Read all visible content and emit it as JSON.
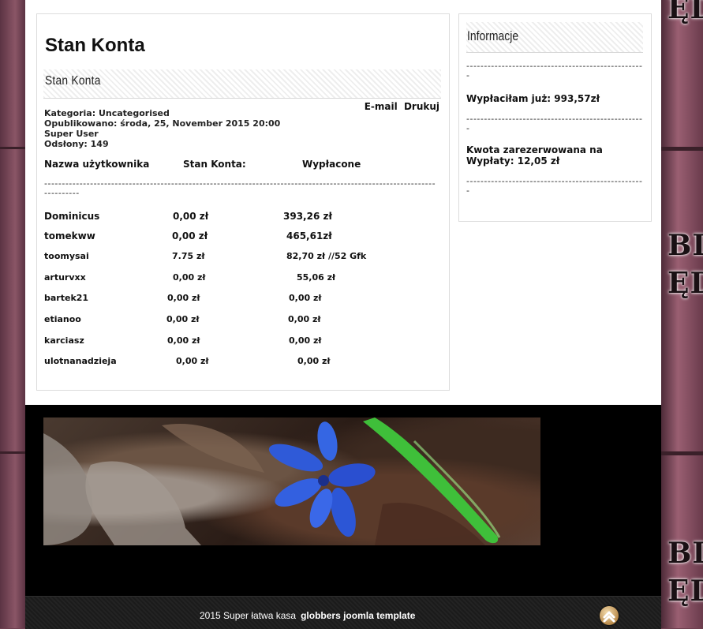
{
  "article": {
    "page_title": "Stan Konta",
    "title": "Stan Konta",
    "tools": {
      "email": "E-mail",
      "print": "Drukuj"
    },
    "meta": {
      "category": "Kategoria: Uncategorised",
      "published": "Opublikowano: środa, 25, November 2015 20:00",
      "author": "Super User",
      "hits": "Odsłony: 149"
    },
    "columns": {
      "user": "Nazwa użytkownika",
      "balance": "Stan Konta:",
      "paid": "Wypłacone"
    },
    "divider": "-------------------------------------------------------------------------------------------------------------------------",
    "rows": [
      {
        "user": "Dominicus",
        "balance": "0,00 zł",
        "paid": "393,26 zł"
      },
      {
        "user": "tomekww",
        "balance": "0,00 zł",
        "paid": "465,61zł"
      },
      {
        "user": "toomysai",
        "balance": "7.75 zł",
        "paid": "82,70 zł  //52 Gfk"
      },
      {
        "user": " arturvxx",
        "balance": "0,00 zł",
        "paid": "55,06 zł"
      },
      {
        "user": "bartek21",
        "balance": "0,00 zł",
        "paid": "0,00 zł"
      },
      {
        "user": "etianoo",
        "balance": "0,00 zł",
        "paid": "0,00 zł"
      },
      {
        "user": "karciasz",
        "balance": "0,00 zł",
        "paid": "0,00 zł"
      },
      {
        "user": "ulotnanadzieja",
        "balance": "0,00 zł",
        "paid": "0,00 zł"
      }
    ]
  },
  "sidebar": {
    "title": "Informacje",
    "dash1": "---------------------------------------------------",
    "paid_total": "Wypłaciłam już: 993,57zł",
    "dash2": "---------------------------------------------------",
    "reserved": "Kwota zarezerwowana na Wypłaty: 12,05 zł",
    "dash3": "---------------------------------------------------"
  },
  "background": {
    "word1": "BIA",
    "word2": "ĘDŁ",
    "word3": "BIA",
    "word4": "ĘD"
  },
  "footer": {
    "text": "2015  Super łatwa kasa",
    "link": "globbers joomla template"
  },
  "colors": {
    "page": "#ffffff",
    "footer": "#000000",
    "wall": "#7a4a5b"
  }
}
